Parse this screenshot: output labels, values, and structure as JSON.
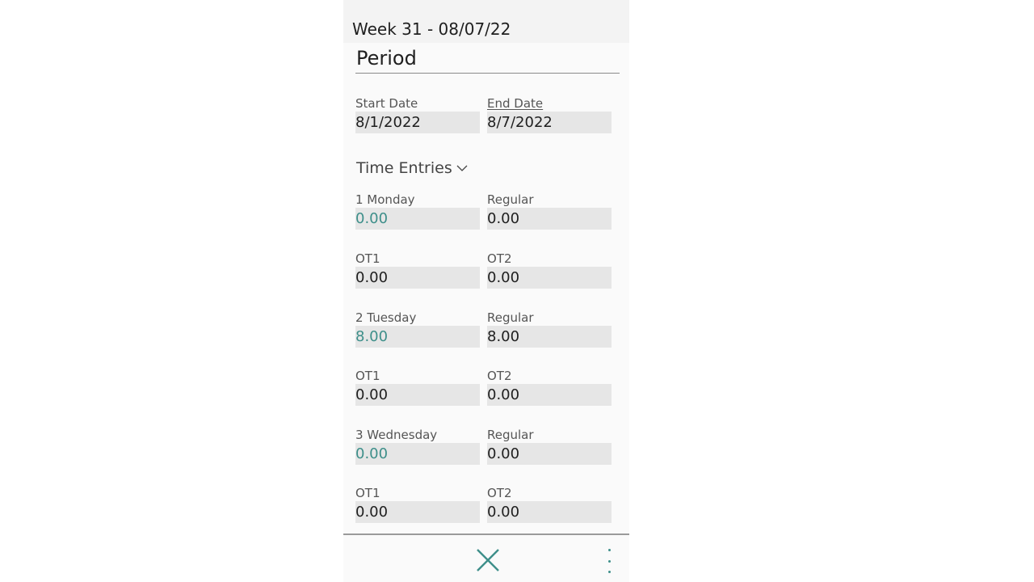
{
  "header": {
    "title": "Week 31 - 08/07/22"
  },
  "period": {
    "section_title": "Period",
    "start_date": {
      "label": "Start Date",
      "value": "8/1/2022"
    },
    "end_date": {
      "label": "End Date",
      "value": "8/7/2022"
    }
  },
  "time_entries": {
    "group_title": "Time Entries",
    "days": [
      {
        "day_label": "1 Monday",
        "day_value": "0.00",
        "regular_label": "Regular",
        "regular_value": "0.00",
        "ot1_label": "OT1",
        "ot1_value": "0.00",
        "ot2_label": "OT2",
        "ot2_value": "0.00"
      },
      {
        "day_label": "2 Tuesday",
        "day_value": "8.00",
        "regular_label": "Regular",
        "regular_value": "8.00",
        "ot1_label": "OT1",
        "ot1_value": "0.00",
        "ot2_label": "OT2",
        "ot2_value": "0.00"
      },
      {
        "day_label": "3 Wednesday",
        "day_value": "0.00",
        "regular_label": "Regular",
        "regular_value": "0.00",
        "ot1_label": "OT1",
        "ot1_value": "0.00",
        "ot2_label": "OT2",
        "ot2_value": "0.00"
      }
    ]
  },
  "icons": {
    "close": "close-icon",
    "more": "more-vertical-icon",
    "chevron": "chevron-down-icon"
  },
  "colors": {
    "accent": "#3e8f8a",
    "field_bg": "#e6e6e6",
    "label": "#555555"
  }
}
